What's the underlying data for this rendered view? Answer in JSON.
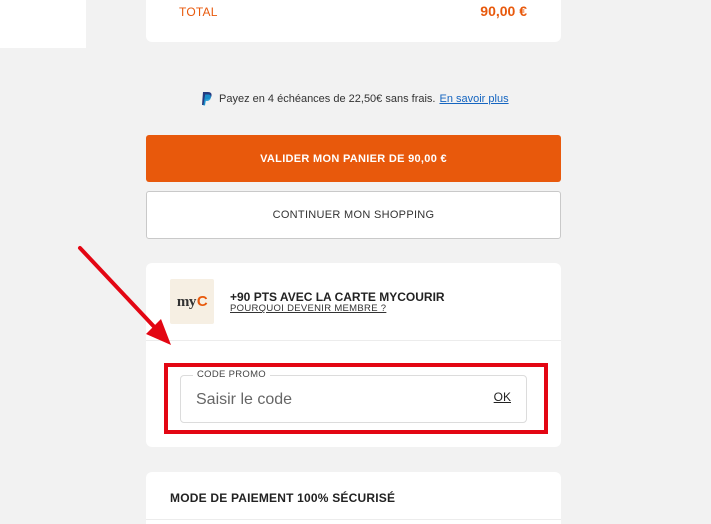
{
  "summary": {
    "total_label": "TOTAL",
    "total_value": "90,00 €"
  },
  "paypal": {
    "icon": "paypal-icon",
    "text": "Payez en 4 échéances de 22,50€ sans frais.",
    "link": "En savoir plus"
  },
  "actions": {
    "validate_label": "VALIDER MON PANIER DE 90,00 €",
    "continue_label": "CONTINUER MON SHOPPING"
  },
  "membership": {
    "logo_text": "my",
    "title": "+90 PTS AVEC LA CARTE MYCOURIR",
    "link": "POURQUOI DEVENIR MEMBRE ?"
  },
  "promo": {
    "legend": "CODE PROMO",
    "placeholder": "Saisir le code",
    "value": "",
    "ok_label": "OK"
  },
  "payment": {
    "title": "MODE DE PAIEMENT 100% SÉCURISÉ"
  },
  "colors": {
    "accent": "#e8590c",
    "annotation": "#e30613",
    "background": "#f2f2f2"
  }
}
